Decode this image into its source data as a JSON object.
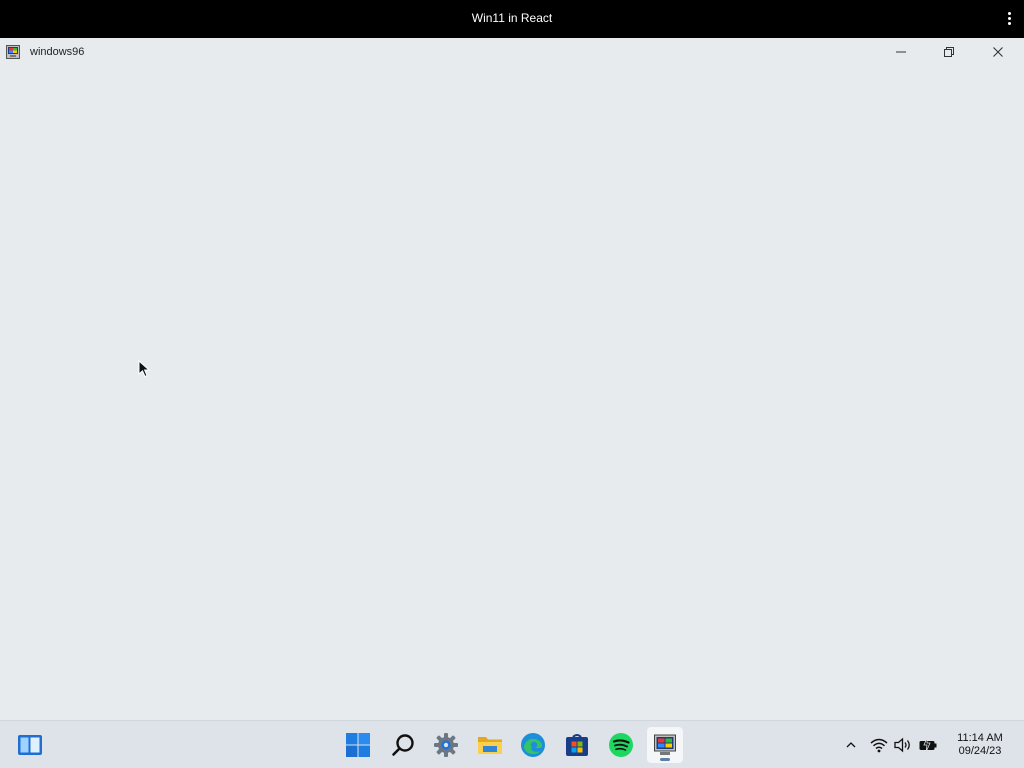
{
  "browser": {
    "title": "Win11 in React",
    "menu_icon": "kebab-menu-icon"
  },
  "window": {
    "title": "windows96",
    "app_icon": "windows96-icon",
    "controls": {
      "minimize_icon": "minimize-icon",
      "maximize_icon": "restore-icon",
      "close_icon": "close-icon"
    }
  },
  "taskbar": {
    "widgets_icon": "widgets-icon",
    "apps": [
      {
        "name": "start",
        "icon": "windows-start-icon"
      },
      {
        "name": "search",
        "icon": "search-icon"
      },
      {
        "name": "settings",
        "icon": "settings-gear-icon"
      },
      {
        "name": "file-explorer",
        "icon": "folder-icon"
      },
      {
        "name": "edge",
        "icon": "edge-browser-icon"
      },
      {
        "name": "store",
        "icon": "store-icon"
      },
      {
        "name": "spotify",
        "icon": "spotify-icon"
      },
      {
        "name": "windows96",
        "icon": "windows96-icon",
        "active": true
      }
    ],
    "tray": {
      "chevron_icon": "chevron-up-icon",
      "wifi_icon": "wifi-icon",
      "volume_icon": "volume-icon",
      "battery_icon": "battery-icon"
    },
    "clock": {
      "time": "11:14 AM",
      "date": "09/24/23"
    }
  },
  "colors": {
    "desktop_bg": "#e7ebee",
    "topbar_bg": "#000000",
    "taskbar_bg": "#dde3e9",
    "accent": "#1a73d9"
  }
}
